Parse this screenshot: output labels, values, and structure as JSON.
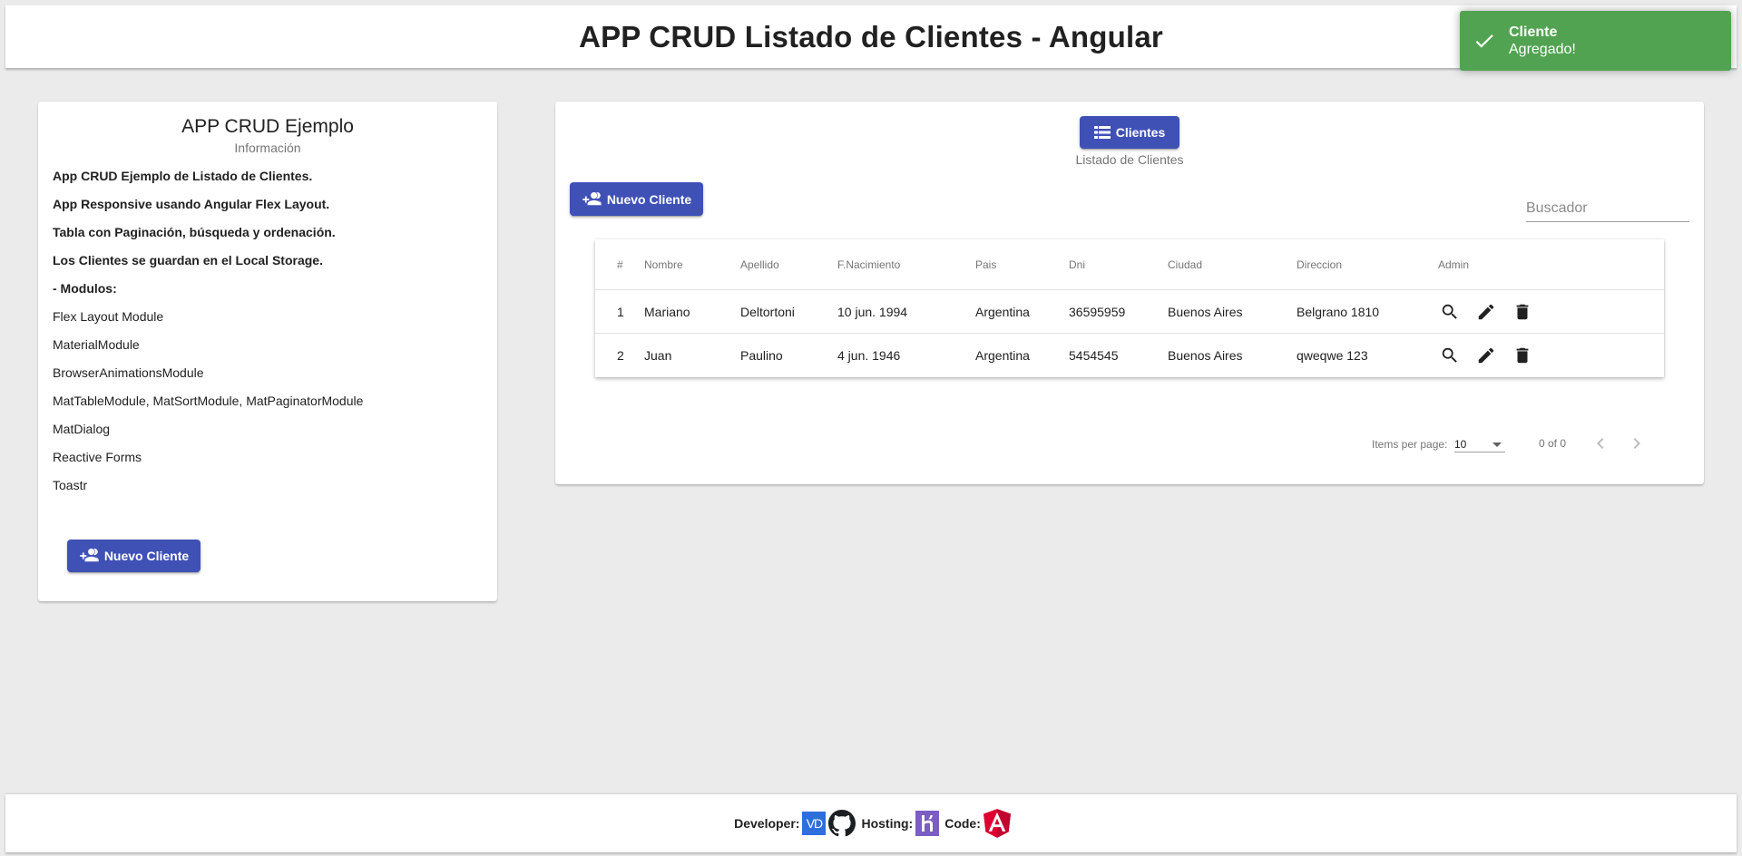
{
  "header": {
    "title": "APP CRUD Listado de Clientes - Angular"
  },
  "toast": {
    "title": "Cliente",
    "message": "Agregado!",
    "color": "#51a351"
  },
  "sidebar": {
    "title": "APP CRUD Ejemplo",
    "subtitle": "Información",
    "lines": [
      "App CRUD Ejemplo de Listado de Clientes.",
      "App Responsive usando Angular Flex Layout.",
      "Tabla con Paginación, búsqueda y ordenación.",
      "Los Clientes se guardan en el Local Storage.",
      "- Modulos:",
      "Flex Layout Module",
      "MaterialModule",
      "BrowserAnimationsModule",
      "MatTableModule, MatSortModule, MatPaginatorModule",
      "MatDialog",
      "Reactive Forms",
      "Toastr"
    ],
    "button_label": "Nuevo Cliente"
  },
  "main": {
    "clientes_button": "Clientes",
    "clientes_subtitle": "Listado de Clientes",
    "nuevo_button": "Nuevo Cliente",
    "search_placeholder": "Buscador",
    "table": {
      "columns": [
        "#",
        "Nombre",
        "Apellido",
        "F.Nacimiento",
        "Pais",
        "Dni",
        "Ciudad",
        "Direccion",
        "Admin"
      ],
      "rows": [
        [
          "1",
          "Mariano",
          "Deltortoni",
          "10 jun. 1994",
          "Argentina",
          "36595959",
          "Buenos Aires",
          "Belgrano 1810"
        ],
        [
          "2",
          "Juan",
          "Paulino",
          "4 jun. 1946",
          "Argentina",
          "5454545",
          "Buenos Aires",
          "qweqwe 123"
        ]
      ]
    },
    "paginator": {
      "items_per_page_label": "Items per page:",
      "page_size": "10",
      "range": "0 of 0"
    }
  },
  "footer": {
    "developer_label": "Developer:",
    "developer_logo": "VD",
    "hosting_label": "Hosting:",
    "code_label": "Code:"
  },
  "colors": {
    "primary": "#3f51b5",
    "angular": "#dd0031",
    "heroku": "#7b5dc4"
  },
  "icons": [
    "check-icon",
    "list-icon",
    "add-user-icon",
    "search-icon",
    "edit-icon",
    "delete-icon",
    "chevron-left-icon",
    "chevron-right-icon",
    "github-icon",
    "heroku-icon",
    "angular-icon"
  ]
}
